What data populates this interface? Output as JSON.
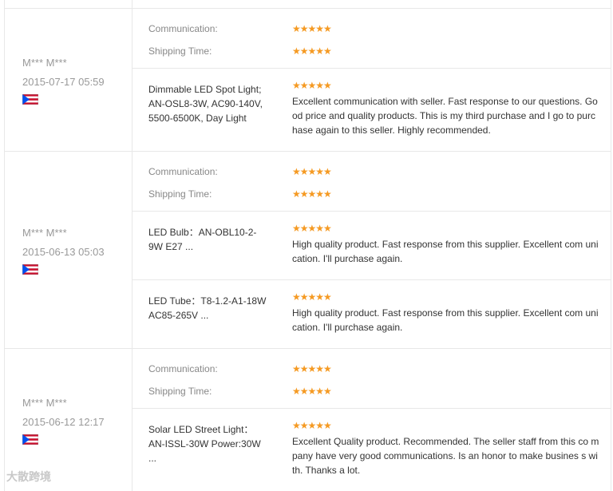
{
  "labels": {
    "communication": "Communication:",
    "shipping": "Shipping Time:"
  },
  "stars_glyph": "★★★★★",
  "colors": {
    "star": "#f59a23",
    "text_muted": "#999999",
    "border": "#e8e8e8"
  },
  "reviews": [
    {
      "buyer": "M*** M***",
      "date": "2015-07-17 05:59",
      "flag_icon": "puerto-rico-flag-icon",
      "items": [
        {
          "product": "Dimmable LED Spot Light; AN-OSL8-3W, AC90-140V, 5500-6500K, Day Light",
          "feedback": "Excellent communication with seller. Fast response to our questions. Good price and quality products. This is my third purchase and I go to purchase again to this seller. Highly recommended."
        }
      ]
    },
    {
      "buyer": "M*** M***",
      "date": "2015-06-13 05:03",
      "flag_icon": "puerto-rico-flag-icon",
      "items": [
        {
          "product": "LED Bulb：AN-OBL10-2-9W E27 ...",
          "feedback": "High quality product. Fast response from this supplier. Excellent com unication. I'll purchase again."
        },
        {
          "product": "LED Tube：T8-1.2-A1-18W AC85-265V ...",
          "feedback": "High quality product. Fast response from this supplier. Excellent com unication. I'll purchase again."
        }
      ]
    },
    {
      "buyer": "M*** M***",
      "date": "2015-06-12 12:17",
      "flag_icon": "puerto-rico-flag-icon",
      "items": [
        {
          "product": "Solar LED Street Light：AN-ISSL-30W Power:30W ...",
          "feedback": "Excellent Quality product. Recommended. The seller staff from this co mpany have very good communications. Is an honor to make busines s with. Thanks a lot."
        }
      ]
    }
  ],
  "watermark": "大散跨境"
}
